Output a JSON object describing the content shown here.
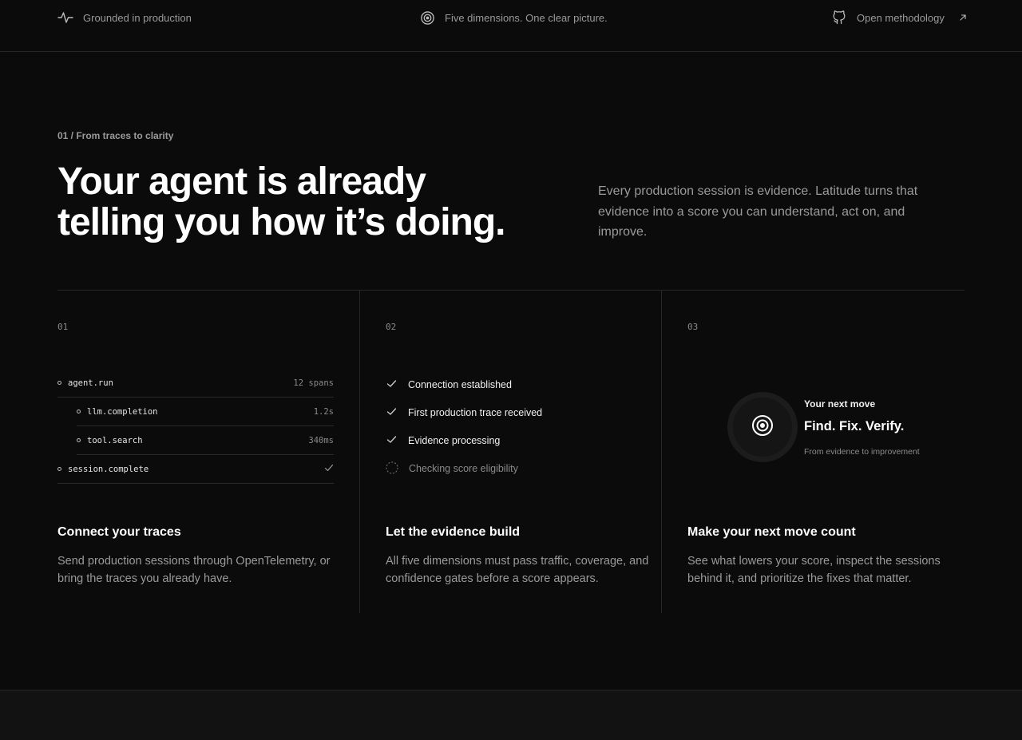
{
  "topbar": {
    "items": [
      {
        "label": "Grounded in production",
        "icon": "activity-icon"
      },
      {
        "label": "Five dimensions. One clear picture.",
        "icon": "target-icon"
      },
      {
        "label": "Open methodology",
        "icon": "github-icon",
        "trailing_icon": "arrow-up-right-icon"
      }
    ]
  },
  "hero": {
    "eyebrow": "01 / From traces to clarity",
    "headline_line1": "Your agent is already",
    "headline_line2": "telling you how it’s doing.",
    "intro": "Every production session is evidence. Latitude turns that evidence into a score you can understand, act on, and improve."
  },
  "steps": [
    {
      "number": "01",
      "title": "Connect your traces",
      "description": "Send production sessions through OpenTelemetry, or bring the traces you already have.",
      "traces": [
        {
          "name": "agent.run",
          "meta": "12 spans"
        },
        {
          "name": "llm.completion",
          "meta": "1.2s"
        },
        {
          "name": "tool.search",
          "meta": "340ms"
        },
        {
          "name": "session.complete",
          "meta_icon": "check-icon"
        }
      ]
    },
    {
      "number": "02",
      "title": "Let the evidence build",
      "description": "All five dimensions must pass traffic, coverage, and confidence gates before a score appears.",
      "checklist": [
        {
          "label": "Connection established",
          "status": "done"
        },
        {
          "label": "First production trace received",
          "status": "done"
        },
        {
          "label": "Evidence processing",
          "status": "done"
        },
        {
          "label": "Checking score eligibility",
          "status": "pending"
        }
      ]
    },
    {
      "number": "03",
      "title": "Make your next move count",
      "description": "See what lowers your score, inspect the sessions behind it, and prioritize the fixes that matter.",
      "move_label": "Your next move",
      "move_title": "Find. Fix. Verify.",
      "move_subtitle": "From evidence to improvement"
    }
  ],
  "colors": {
    "background": "#0b0b0b",
    "text": "#ffffff",
    "muted": "#9a9a9a",
    "border": "#262626"
  }
}
